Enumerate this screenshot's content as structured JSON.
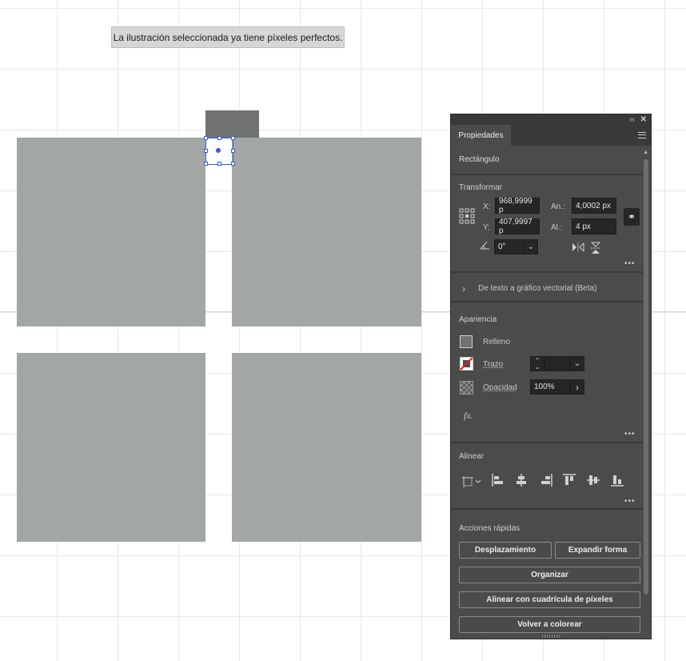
{
  "canvas": {
    "toast_message": "La ilustración seleccionada ya tiene píxeles perfectos."
  },
  "panel": {
    "collapse_glyph": "‹‹",
    "close_glyph": "✕",
    "tab_label": "Propiedades",
    "object_type": "Rectángulo",
    "transform": {
      "header": "Transformar",
      "x_label": "X:",
      "x_value": "968,9999 p",
      "y_label": "Y:",
      "y_value": "407,9997 p",
      "w_label": "An.:",
      "w_value": "4,0002 px",
      "h_label": "Al.:",
      "h_value": "4 px",
      "angle_value": "0°",
      "more": "•••"
    },
    "text_to_vector": {
      "label": "De texto a gráfico vectorial (Beta)"
    },
    "appearance": {
      "header": "Apariencia",
      "fill_label": "Relleno",
      "stroke_label": "Trazo",
      "opacity_label": "Opacidad",
      "opacity_value": "100%",
      "fx_label": "fx.",
      "more": "•••"
    },
    "align": {
      "header": "Alinear",
      "more": "•••"
    },
    "quick_actions": {
      "header": "Acciones rápidas",
      "offset_path": "Desplazamiento",
      "expand_shape": "Expandir forma",
      "arrange": "Organizar",
      "align_pixel_grid": "Alinear con cuadrícula de píxeles",
      "recolor": "Volver a colorear"
    }
  },
  "colors": {
    "artwork_gray": "#a3a7a3",
    "selected_rect": "#6f726f",
    "selection_blue": "#3a5ddc",
    "panel_bg": "#4b4b4b"
  }
}
